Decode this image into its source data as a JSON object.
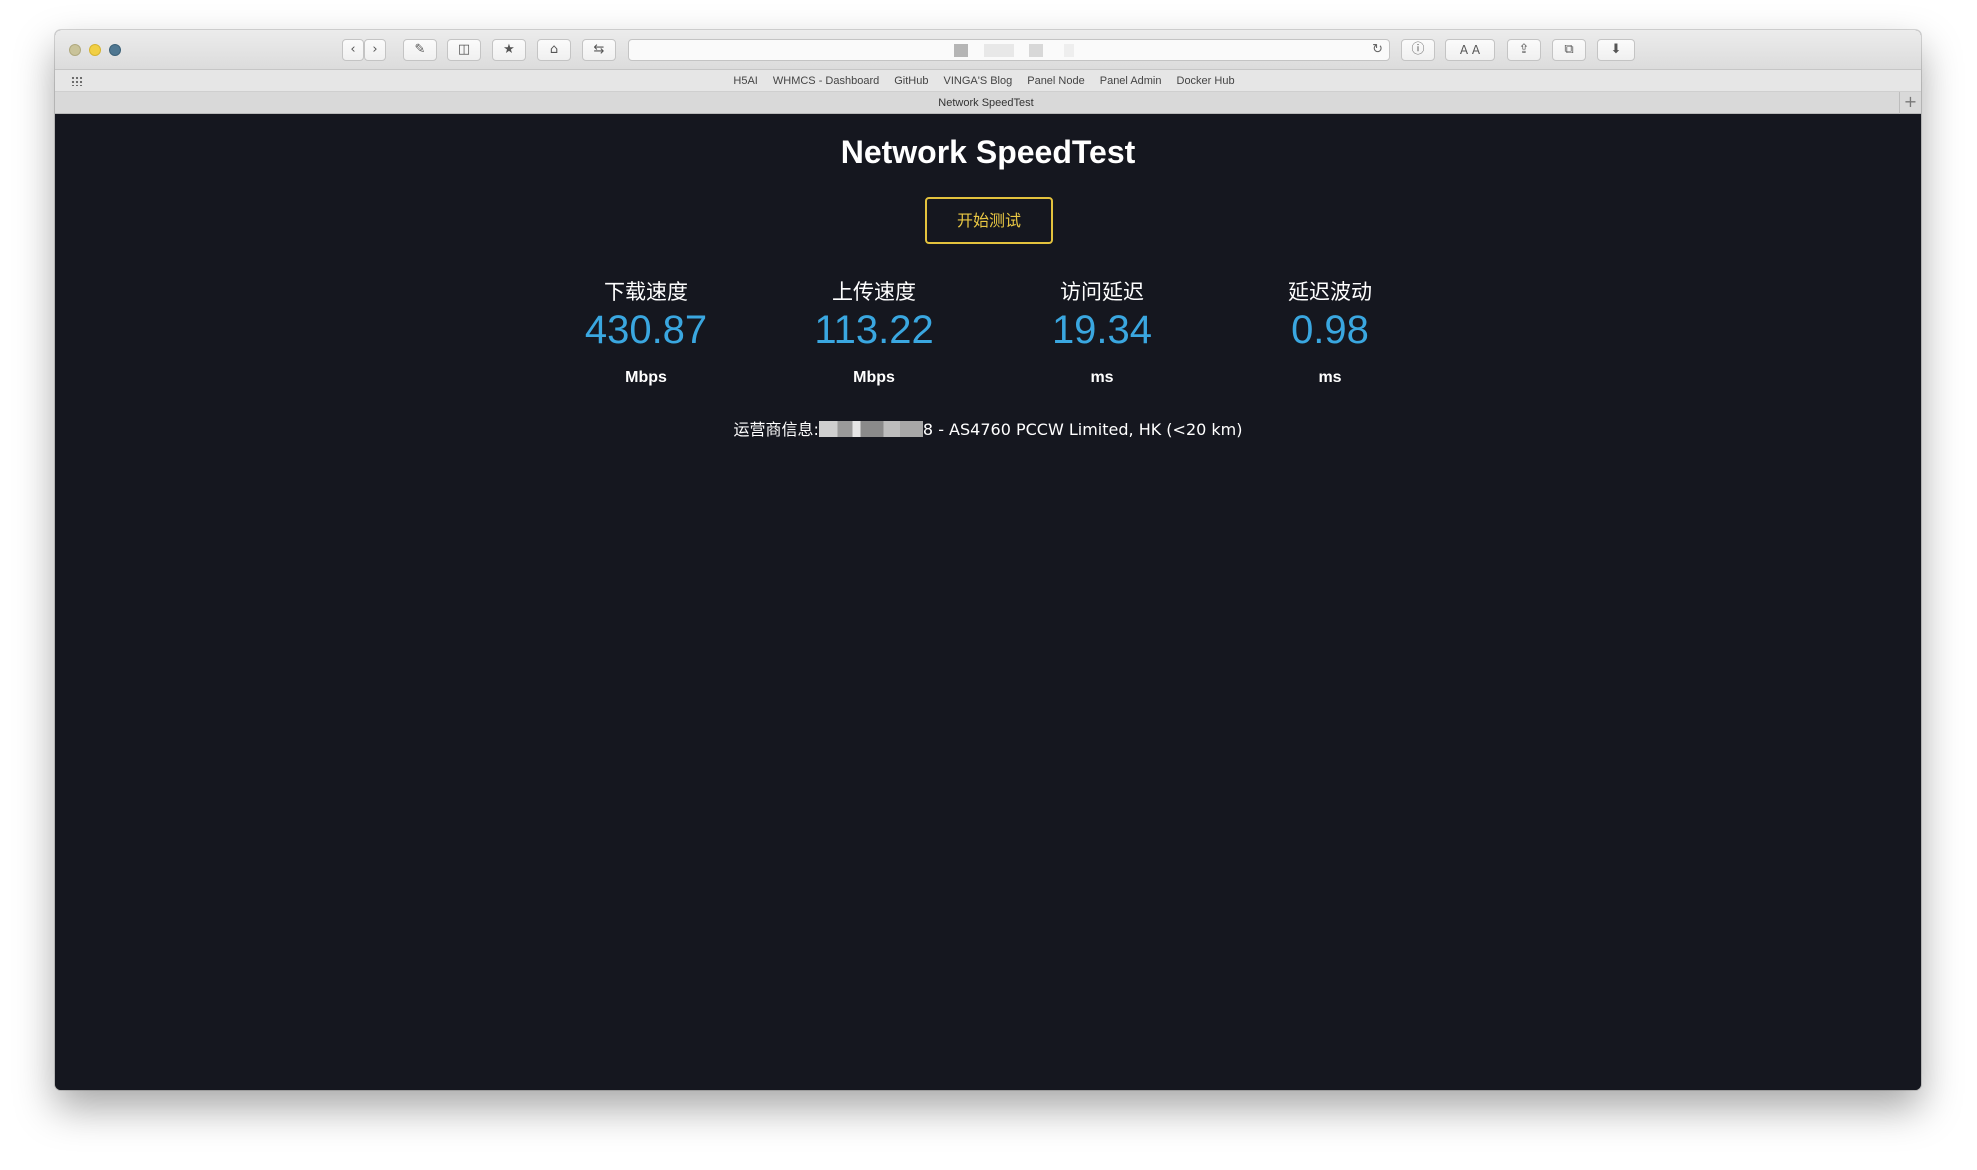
{
  "browser": {
    "address_bar": "",
    "bookmarks": [
      "H5AI",
      "WHMCS - Dashboard",
      "GitHub",
      "VINGA'S Blog",
      "Panel Node",
      "Panel Admin",
      "Docker Hub"
    ],
    "tab_title": "Network SpeedTest",
    "new_tab_label": "+",
    "toolbar_icons": [
      "back-icon",
      "forward-icon",
      "edit-icon",
      "sidebar-icon",
      "bookmark-icon",
      "home-icon",
      "share-arrows-icon",
      "reload-icon",
      "info-icon",
      "font-size-icon",
      "share-icon",
      "tabs-icon",
      "download-icon"
    ]
  },
  "page": {
    "title": "Network SpeedTest",
    "start_button": "开始测试",
    "metrics": [
      {
        "label": "下载速度",
        "value": "430.87",
        "unit": "Mbps"
      },
      {
        "label": "上传速度",
        "value": "113.22",
        "unit": "Mbps"
      },
      {
        "label": "访问延迟",
        "value": "19.34",
        "unit": "ms"
      },
      {
        "label": "延迟波动",
        "value": "0.98",
        "unit": "ms"
      }
    ],
    "isp_prefix": "运营商信息:",
    "isp_suffix": "8 - AS4760 PCCW Limited, HK (<20 km)"
  },
  "colors": {
    "background": "#15171f",
    "accent_value": "#3aa7e0",
    "button_border": "#e3c23d"
  }
}
